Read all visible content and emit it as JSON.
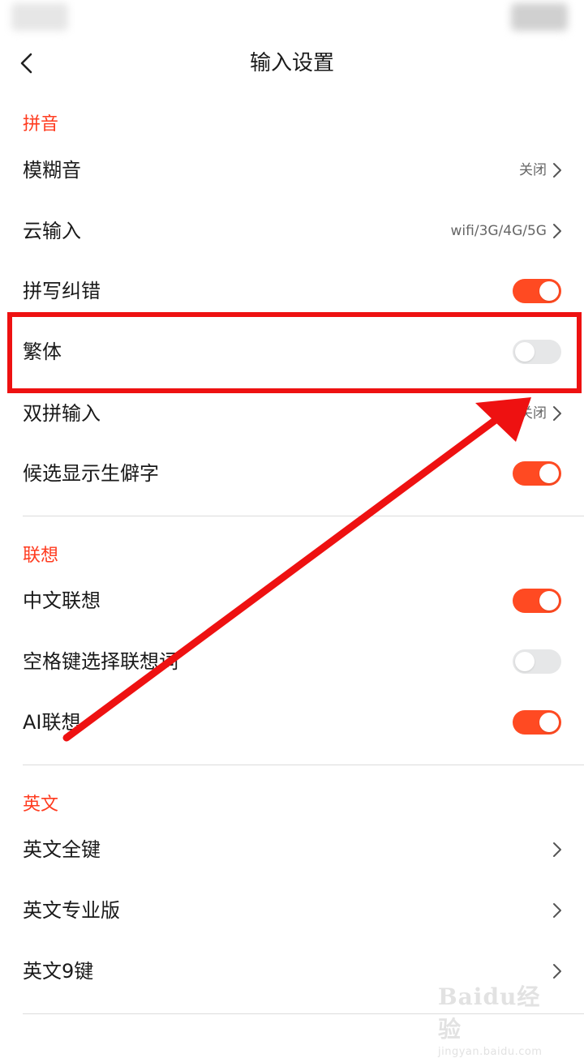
{
  "header": {
    "title": "输入设置"
  },
  "sections": [
    {
      "title": "拼音",
      "items": [
        {
          "label": "模糊音",
          "value": "关闭"
        },
        {
          "label": "云输入",
          "value": "wifi/3G/4G/5G"
        },
        {
          "label": "拼写纠错",
          "toggle": "on"
        },
        {
          "label": "繁体",
          "toggle": "off"
        },
        {
          "label": "双拼输入",
          "value": "关闭"
        },
        {
          "label": "候选显示生僻字",
          "toggle": "on"
        }
      ]
    },
    {
      "title": "联想",
      "items": [
        {
          "label": "中文联想",
          "toggle": "on"
        },
        {
          "label": "空格键选择联想词",
          "toggle": "off"
        },
        {
          "label": "AI联想",
          "toggle": "on"
        }
      ]
    },
    {
      "title": "英文",
      "items": [
        {
          "label": "英文全键"
        },
        {
          "label": "英文专业版"
        },
        {
          "label": "英文9键"
        }
      ]
    }
  ],
  "colors": {
    "accent": "#ff4a22",
    "section_title": "#ff3b1f",
    "annotation_red": "#ee1111",
    "toggle_off": "#e6e7e8"
  },
  "watermark": {
    "main": "Baidu经验",
    "sub": "jingyan.baidu.com"
  }
}
